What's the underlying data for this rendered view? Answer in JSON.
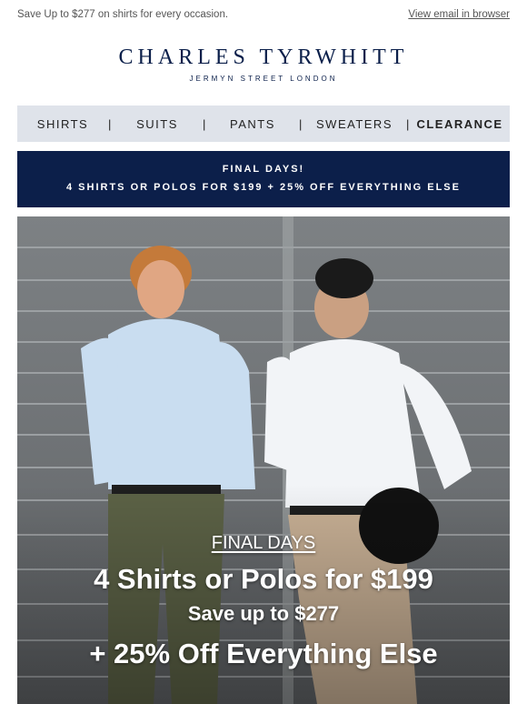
{
  "preheader": {
    "text": "Save Up to $277 on shirts for every occasion.",
    "view_in_browser": "View email in browser"
  },
  "brand": {
    "name": "CHARLES TYRWHITT",
    "tagline": "JERMYN STREET LONDON",
    "color": "#0b1f4a"
  },
  "nav": {
    "items": [
      "SHIRTS",
      "SUITS",
      "PANTS",
      "SWEATERS",
      "CLEARANCE"
    ],
    "separator": "|"
  },
  "banner": {
    "line1": "FINAL DAYS!",
    "line2": "4 SHIRTS OR POLOS FOR $199 + 25% OFF EVERYTHING ELSE",
    "background": "#0c1f4a"
  },
  "hero": {
    "line1": "FINAL DAYS",
    "line2": "4 Shirts or Polos for $199",
    "line3": "Save up to $277",
    "line4": "+ 25% Off Everything Else"
  }
}
